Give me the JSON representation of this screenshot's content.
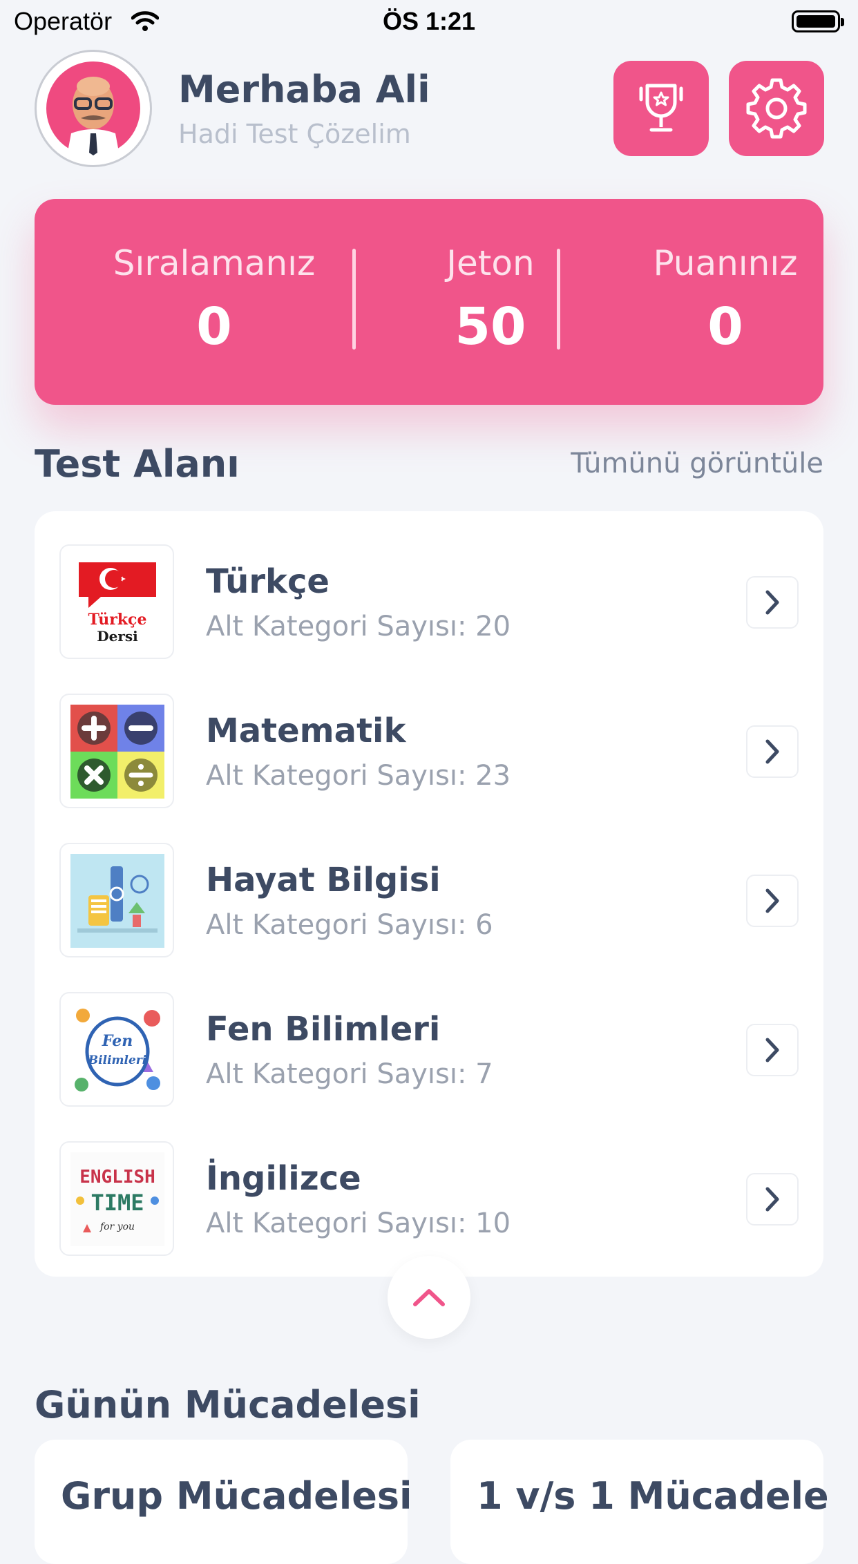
{
  "status_bar": {
    "carrier": "Operatör",
    "time": "ÖS 1:21"
  },
  "header": {
    "greeting": "Merhaba Ali",
    "subtitle": "Hadi Test Çözelim"
  },
  "stats": [
    {
      "label": "Sıralamanız",
      "value": "0"
    },
    {
      "label": "Jeton",
      "value": "50"
    },
    {
      "label": "Puanınız",
      "value": "0"
    }
  ],
  "test_area": {
    "title": "Test Alanı",
    "see_all": "Tümünü görüntüle",
    "items": [
      {
        "name": "Türkçe",
        "count": "Alt Kategori Sayısı: 20",
        "thumb_text": [
          "Türkçe",
          "Dersi"
        ]
      },
      {
        "name": "Matematik",
        "count": "Alt Kategori Sayısı: 23"
      },
      {
        "name": "Hayat Bilgisi",
        "count": "Alt Kategori Sayısı: 6"
      },
      {
        "name": "Fen Bilimleri",
        "count": "Alt Kategori Sayısı: 7",
        "thumb_text": [
          "Fen",
          "Bilimleri"
        ]
      },
      {
        "name": "İngilizce",
        "count": "Alt Kategori Sayısı: 10",
        "thumb_text": [
          "ENGLISH",
          "TIME",
          "for you"
        ]
      }
    ]
  },
  "daily": {
    "title": "Günün Mücadelesi",
    "cards": [
      "Grup Mücadelesi",
      "1 v/s 1 Mücadele"
    ]
  },
  "colors": {
    "accent": "#f0558a",
    "background": "#f3f5f9",
    "text": "#3d4a63"
  }
}
